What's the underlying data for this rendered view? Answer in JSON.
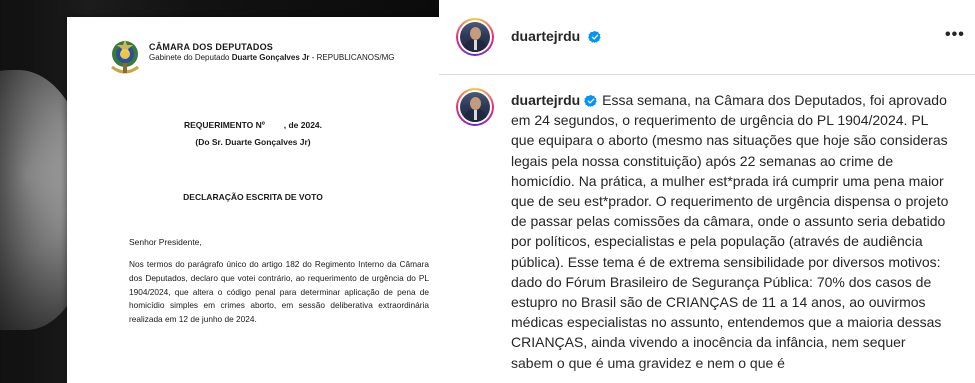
{
  "post": {
    "username": "duartejrdu",
    "more_icon": "more-horizontal-icon",
    "verified_icon": "verified-badge-icon"
  },
  "document": {
    "org": "CÂMARA DOS DEPUTADOS",
    "office_prefix": "Gabinete do Deputado ",
    "office_name": "Duarte Gonçalves Jr",
    "office_suffix": " - REPUBLICANOS/MG",
    "requirement": "REQUERIMENTO Nº        , de 2024.",
    "author": "(Do Sr. Duarte Gonçalves Jr)",
    "declaration": "DECLARAÇÃO ESCRITA DE VOTO",
    "salutation": "Senhor Presidente,",
    "body": "Nos termos do parágrafo único do artigo 182 do Regimento Interno da Câmara dos Deputados, declaro que votei contrário, ao requerimento de urgência do PL 1904/2024, que altera o código penal para determinar aplicação de pena de homicídio simples em crimes aborto, em sessão deliberativa extraordinária realizada em 12 de junho de 2024."
  },
  "caption": {
    "username": "duartejrdu",
    "text": "Essa semana, na Câmara dos Deputados, foi aprovado em 24 segundos, o requerimento de urgência do PL 1904/2024. PL que equipara o aborto (mesmo nas situações que hoje são consideras legais pela nossa constituição) após 22 semanas ao crime de homicídio. Na prática, a mulher est*prada irá cumprir uma pena maior que de seu est*prador. O requerimento de urgência dispensa o projeto de passar pelas comissões da câmara, onde o assunto seria debatido por políticos, especialistas e pela população (através de audiência pública). Esse tema é de extrema sensibilidade por diversos motivos: dado do Fórum Brasileiro de Segurança Pública: 70% dos casos de estupro no Brasil são de CRIANÇAS de 11 a 14 anos, ao ouvirmos médicas especialistas no assunto, entendemos que a maioria dessas CRIANÇAS, ainda vivendo a inocência da infância, nem sequer sabem o que é uma gravidez e nem o que é"
  },
  "colors": {
    "verified": "#0095f6",
    "text": "#262626",
    "divider": "#dbdbdb"
  }
}
